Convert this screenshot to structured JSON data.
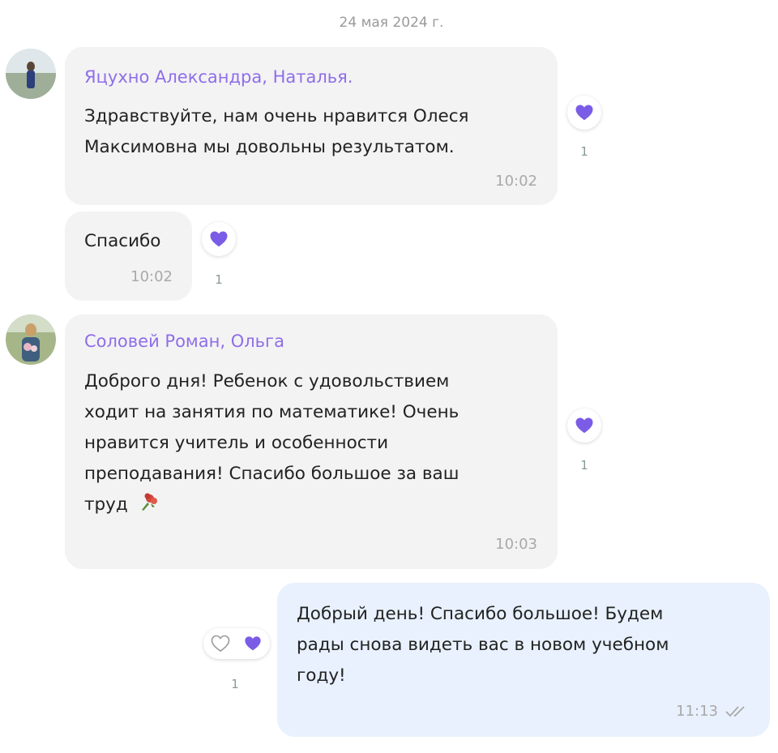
{
  "chat": {
    "date": "24 мая 2024 г.",
    "messages": [
      {
        "sender": "Яцухно Александра, Наталья.",
        "lines": [
          "Здравствуйте, нам очень нравится Олеся",
          "Максимовна мы довольны результатом."
        ],
        "time": "10:02",
        "reaction_icon": "heart-icon",
        "reaction_count": "1"
      },
      {
        "lines": [
          "Спасибо"
        ],
        "time": "10:02",
        "reaction_icon": "heart-icon",
        "reaction_count": "1"
      },
      {
        "sender": "Соловей Роман, Ольга",
        "lines": [
          "Доброго дня! Ребенок с удовольствием",
          "ходит на занятия по математике! Очень",
          "нравится учитель и особенности",
          "преподавания! Спасибо большое за ваш",
          "труд"
        ],
        "emoji_icon": "bouquet-icon",
        "time": "10:03",
        "reaction_icon": "heart-icon",
        "reaction_count": "1"
      },
      {
        "outgoing": true,
        "lines": [
          "Добрый день! Спасибо большое! Будем",
          "рады снова видеть вас в новом учебном",
          "году!"
        ],
        "time": "11:13",
        "status_icon": "double-check-icon",
        "reaction_icons": [
          "heart-outline-icon",
          "heart-icon"
        ],
        "reaction_count": "1"
      }
    ]
  },
  "colors": {
    "accent": "#7b5ce6",
    "sender_name": "#8f6ee8",
    "incoming_bubble": "#f3f3f4",
    "outgoing_bubble": "#e8f1fd",
    "meta_text": "#a9a9a9"
  }
}
